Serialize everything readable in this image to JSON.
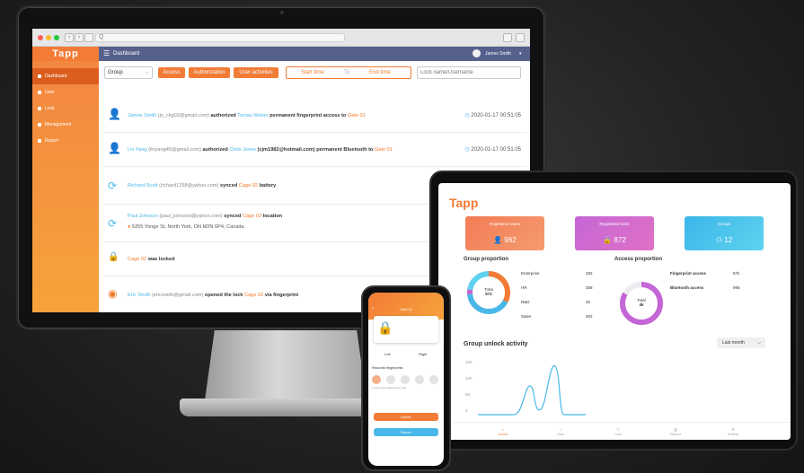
{
  "desktop": {
    "url_placeholder": "Q",
    "logo": "Tapp",
    "sidebar": [
      {
        "label": "Dashboard",
        "active": true
      },
      {
        "label": "User"
      },
      {
        "label": "Lock"
      },
      {
        "label": "Management"
      },
      {
        "label": "Report"
      }
    ],
    "topbar": {
      "title": "Dashboard",
      "user": "James Smith"
    },
    "filters": {
      "group_select": "Group",
      "access": "Access",
      "authorization": "Authorization",
      "user_activities": "User activities",
      "start_time": "Start time",
      "to": "To",
      "end_time": "End time",
      "search_placeholder": "Lock name/Username"
    },
    "activities": [
      {
        "actor": "James Smith",
        "email": "(js_ckg02@gmail.com)",
        "verb": "authorized",
        "target": "Tomas Weber",
        "rest": "permanent fingerprint access to",
        "lock": "Gate 01",
        "time": "2020-01-17 00:51:05"
      },
      {
        "actor": "Lin Yang",
        "email": "(linyang45@gmail.com)",
        "verb": "authorized",
        "target": "Chris Jones",
        "rest": "(cjm1982@hotmail.com) permanent Bluetooth to",
        "lock": "Gate 01",
        "time": "2020-01-17 00:51:05"
      },
      {
        "actor": "Richard Scott",
        "email": "(richard1258@yahoo.com)",
        "verb": "synced",
        "target": "Cage 02",
        "rest": "battery"
      },
      {
        "actor": "Paul Johnson",
        "email": "(paul_johnson@yahoo.com)",
        "verb": "synced",
        "target": "Cage 03",
        "rest": "location",
        "address": "5255 Yonge St, North York, ON M2N 6P4, Canada"
      },
      {
        "lock": "Cage 02",
        "rest": "was locked"
      },
      {
        "actor": "Eric Smith",
        "email": "(ericsmith@gmail.com)",
        "verb": "opened the lock",
        "target": "Cage 02",
        "rest": "via fingerprint"
      }
    ]
  },
  "tablet": {
    "logo": "Tapp",
    "cards": [
      {
        "label": "Registered users",
        "value": "962"
      },
      {
        "label": "Registered locks",
        "value": "872"
      },
      {
        "label": "Groups",
        "value": "12"
      }
    ],
    "group_proportion": {
      "title": "Group proportion",
      "donut_label": "Total",
      "donut_value": "872",
      "items": [
        {
          "name": "Enterprise",
          "value": "282"
        },
        {
          "name": "HR",
          "value": "358"
        },
        {
          "name": "R&D",
          "value": "30"
        },
        {
          "name": "Sales",
          "value": "302"
        }
      ]
    },
    "access_proportion": {
      "title": "Access proportion",
      "donut_label": "Total",
      "donut_value": "4k",
      "items": [
        {
          "name": "Fingerprint access",
          "value": "57k"
        },
        {
          "name": "Bluetooth access",
          "value": "995"
        }
      ]
    },
    "unlock": {
      "title": "Group unlock activity",
      "range": "Last month",
      "yticks": [
        "150",
        "100",
        "50",
        "0"
      ]
    },
    "tabs": [
      "Home",
      "User",
      "Lock",
      "Report",
      "Setting"
    ]
  },
  "phone": {
    "title": "Gate 01",
    "tabs": [
      "Left",
      "Right"
    ],
    "section": "Recorded fingerprints",
    "fingers": [
      "Thumb",
      "Index",
      "Middle",
      "Ring",
      "Little"
    ],
    "button_primary": "Delete",
    "button_secondary": "Return"
  }
}
